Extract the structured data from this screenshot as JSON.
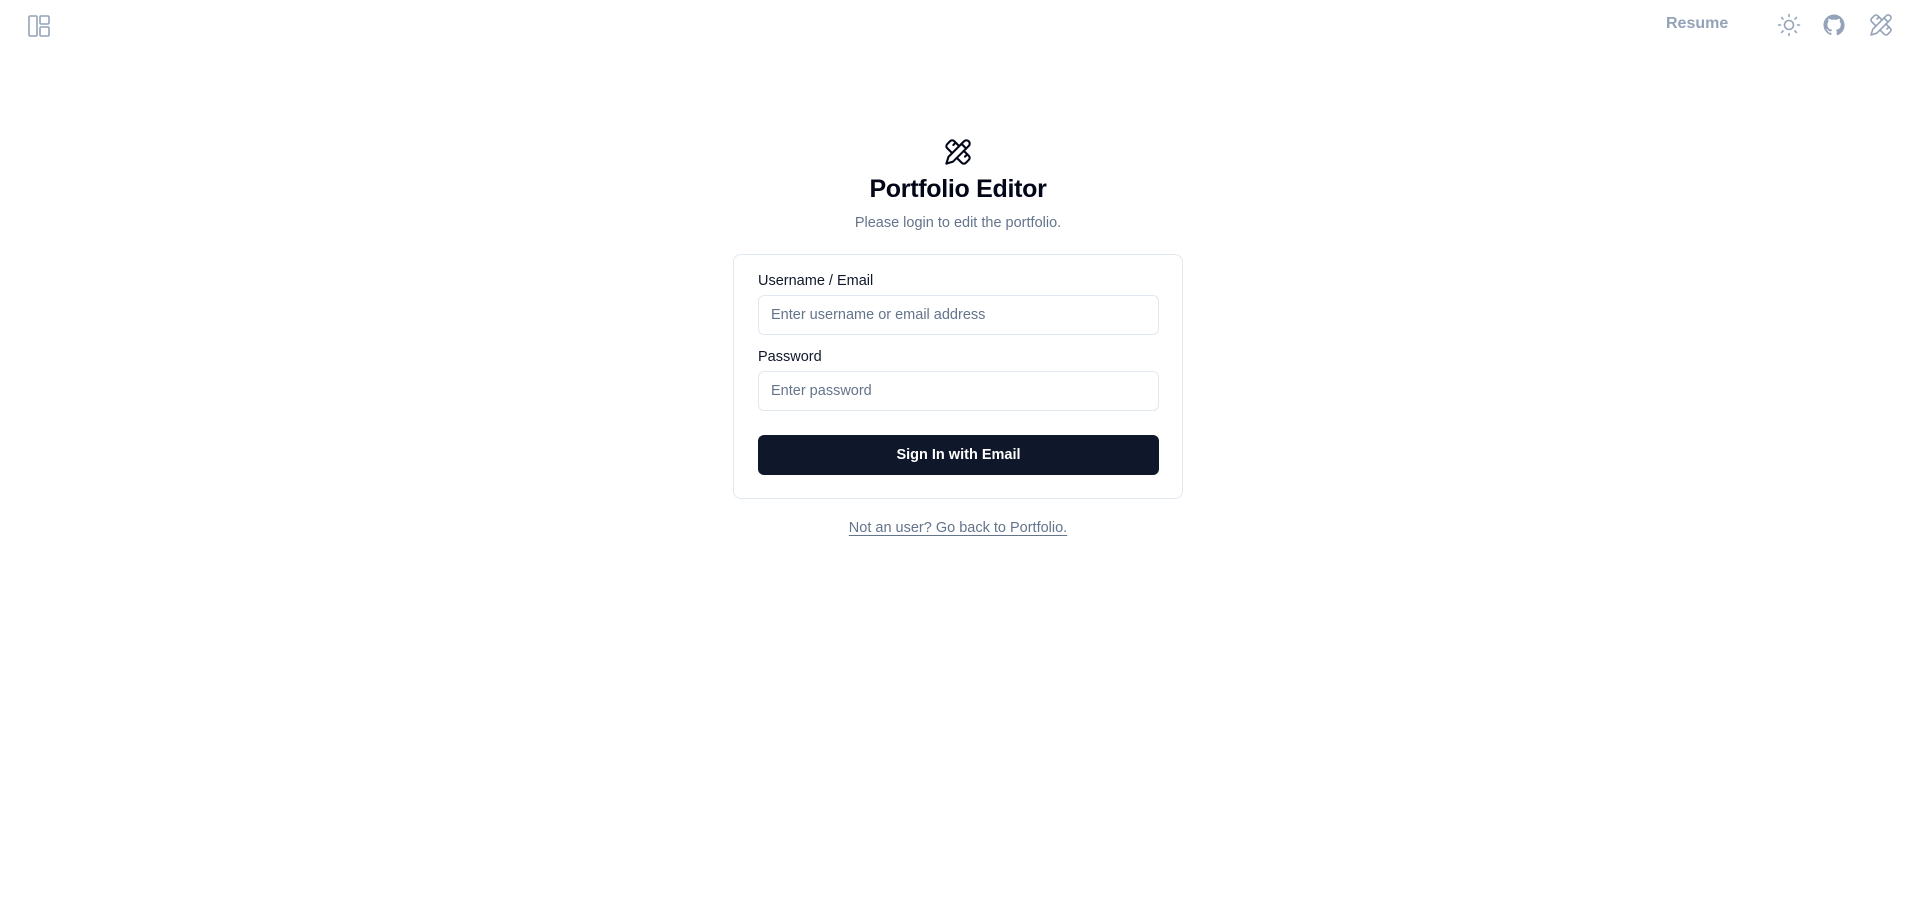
{
  "topbar": {
    "layout_icon": "layout-dashboard-icon",
    "resume_label": "Resume",
    "theme_icon": "sun-icon",
    "github_icon": "github-icon",
    "editor_icon": "pencil-ruler-icon"
  },
  "header": {
    "logo_icon": "pencil-ruler-icon",
    "title": "Portfolio Editor",
    "subtitle": "Please login to edit the portfolio."
  },
  "form": {
    "username_label": "Username / Email",
    "username_placeholder": "Enter username or email address",
    "username_value": "",
    "password_label": "Password",
    "password_placeholder": "Enter password",
    "password_value": "",
    "submit_label": "Sign In with Email"
  },
  "footer": {
    "back_link_label": "Not an user? Go back to Portfolio."
  },
  "colors": {
    "primary_button": "#0f172a",
    "muted_text": "#64748b",
    "border": "#e2e8f0",
    "topbar_icons": "#94a3b8"
  }
}
